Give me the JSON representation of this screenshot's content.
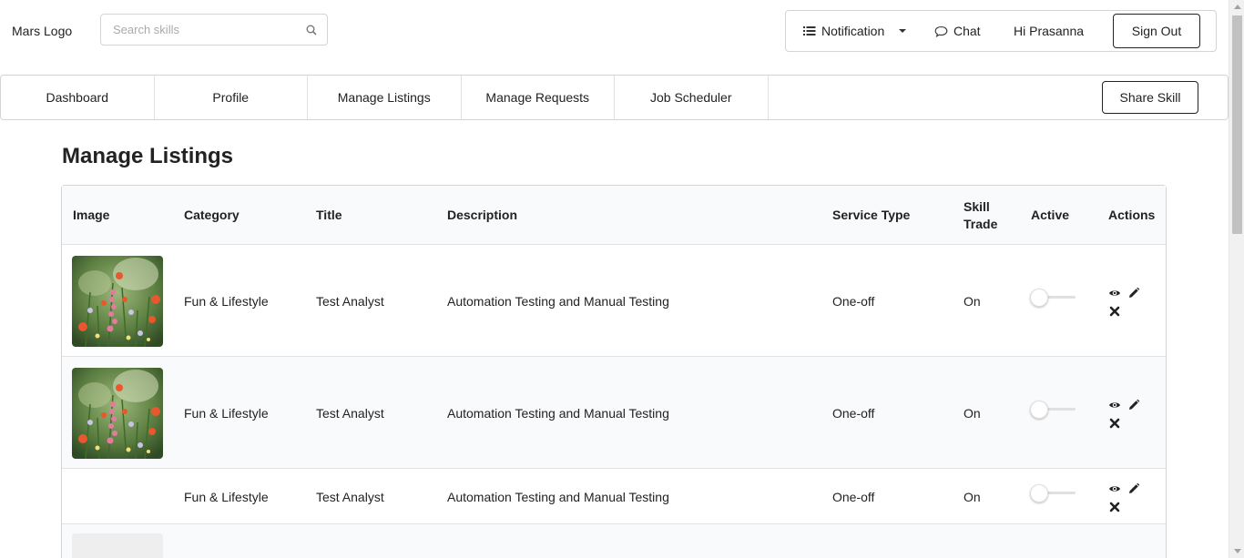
{
  "header": {
    "logo": "Mars Logo",
    "search_placeholder": "Search skills",
    "notification_label": "Notification",
    "chat_label": "Chat",
    "greeting": "Hi Prasanna",
    "signout_label": "Sign Out"
  },
  "nav": {
    "tabs": [
      "Dashboard",
      "Profile",
      "Manage Listings",
      "Manage Requests",
      "Job Scheduler"
    ],
    "share_label": "Share Skill"
  },
  "page_title": "Manage Listings",
  "table": {
    "columns": [
      "Image",
      "Category",
      "Title",
      "Description",
      "Service Type",
      "Skill Trade",
      "Active",
      "Actions"
    ],
    "rows": [
      {
        "category": "Fun & Lifestyle",
        "title": "Test Analyst",
        "description": "Automation Testing and Manual Testing",
        "service_type": "One-off",
        "skill_trade": "On",
        "active": false,
        "has_image": true
      },
      {
        "category": "Fun & Lifestyle",
        "title": "Test Analyst",
        "description": "Automation Testing and Manual Testing",
        "service_type": "One-off",
        "skill_trade": "On",
        "active": false,
        "has_image": true
      },
      {
        "category": "Fun & Lifestyle",
        "title": "Test Analyst",
        "description": "Automation Testing and Manual Testing",
        "service_type": "One-off",
        "skill_trade": "On",
        "active": false,
        "has_image": false
      }
    ]
  },
  "icons": {
    "search": "search-icon",
    "notification": "list-icon",
    "chat": "chat-bubble-icon",
    "view": "eye-icon",
    "edit": "pencil-icon",
    "delete": "close-icon"
  }
}
